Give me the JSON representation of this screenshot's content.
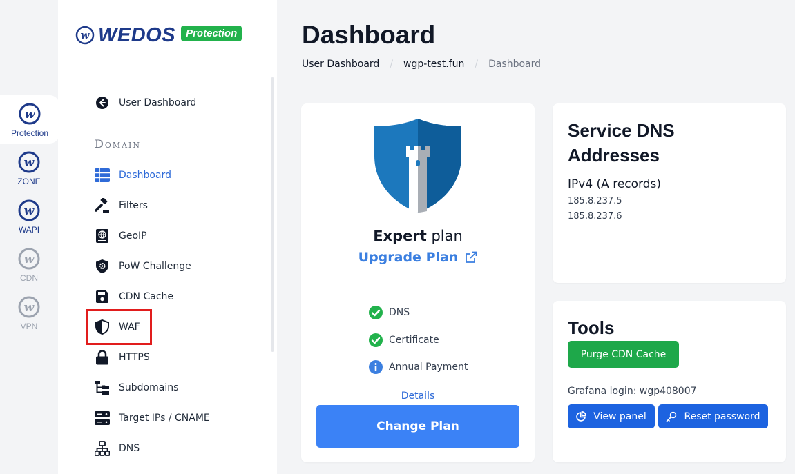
{
  "rail": {
    "items": [
      {
        "label": "Protection"
      },
      {
        "label": "ZONE"
      },
      {
        "label": "WAPI"
      },
      {
        "label": "CDN"
      },
      {
        "label": "VPN"
      }
    ]
  },
  "brand": {
    "name": "WEDOS",
    "badge": "Protection"
  },
  "sidebar": {
    "back_label": "User Dashboard",
    "section_label": "Domain",
    "items": [
      {
        "label": "Dashboard"
      },
      {
        "label": "Filters"
      },
      {
        "label": "GeoIP"
      },
      {
        "label": "PoW Challenge"
      },
      {
        "label": "CDN Cache"
      },
      {
        "label": "WAF"
      },
      {
        "label": "HTTPS"
      },
      {
        "label": "Subdomains"
      },
      {
        "label": "Target IPs / CNAME"
      },
      {
        "label": "DNS"
      }
    ]
  },
  "header": {
    "title": "Dashboard",
    "breadcrumb": [
      "User Dashboard",
      "wgp-test.fun",
      "Dashboard"
    ]
  },
  "plan": {
    "name": "Expert",
    "suffix": "plan",
    "upgrade_label": "Upgrade Plan",
    "features": [
      {
        "label": "DNS",
        "status": "ok"
      },
      {
        "label": "Certificate",
        "status": "ok"
      },
      {
        "label": "Annual Payment",
        "status": "info"
      }
    ],
    "details_label": "Details",
    "change_label": "Change Plan"
  },
  "dns": {
    "title_line1": "Service DNS",
    "title_line2": "Addresses",
    "subtitle": "IPv4 (A records)",
    "ips": [
      "185.8.237.5",
      "185.8.237.6"
    ]
  },
  "tools": {
    "title": "Tools",
    "purge_label": "Purge CDN Cache",
    "grafana_text": "Grafana login: wgp408007",
    "view_label": "View panel",
    "reset_label": "Reset password"
  },
  "colors": {
    "accent": "#3b82f6",
    "brand": "#1e3a8a",
    "success": "#1ea84a",
    "highlight": "#e11d1d"
  }
}
